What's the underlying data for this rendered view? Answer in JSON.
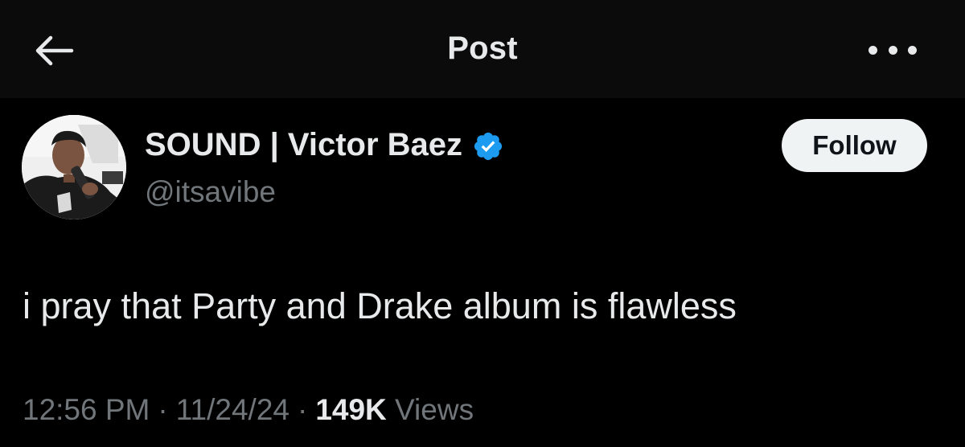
{
  "header": {
    "title": "Post",
    "back_icon": "arrow-left-icon",
    "more_icon": "more-horizontal-icon"
  },
  "author": {
    "display_name": "SOUND | Victor Baez",
    "handle": "@itsavibe",
    "verified": true,
    "verified_color": "#1d9bf0",
    "follow_label": "Follow"
  },
  "post": {
    "text": "i pray that Party and Drake album is flawless",
    "time": "12:56 PM",
    "date": "11/24/24",
    "separator": "·",
    "views_count": "149K",
    "views_label": "Views"
  },
  "colors": {
    "background": "#000000",
    "header_background": "#0b0b0b",
    "primary_text": "#e7e9ea",
    "secondary_text": "#71767b",
    "button_background": "#eff3f4",
    "button_text": "#0f1419"
  }
}
